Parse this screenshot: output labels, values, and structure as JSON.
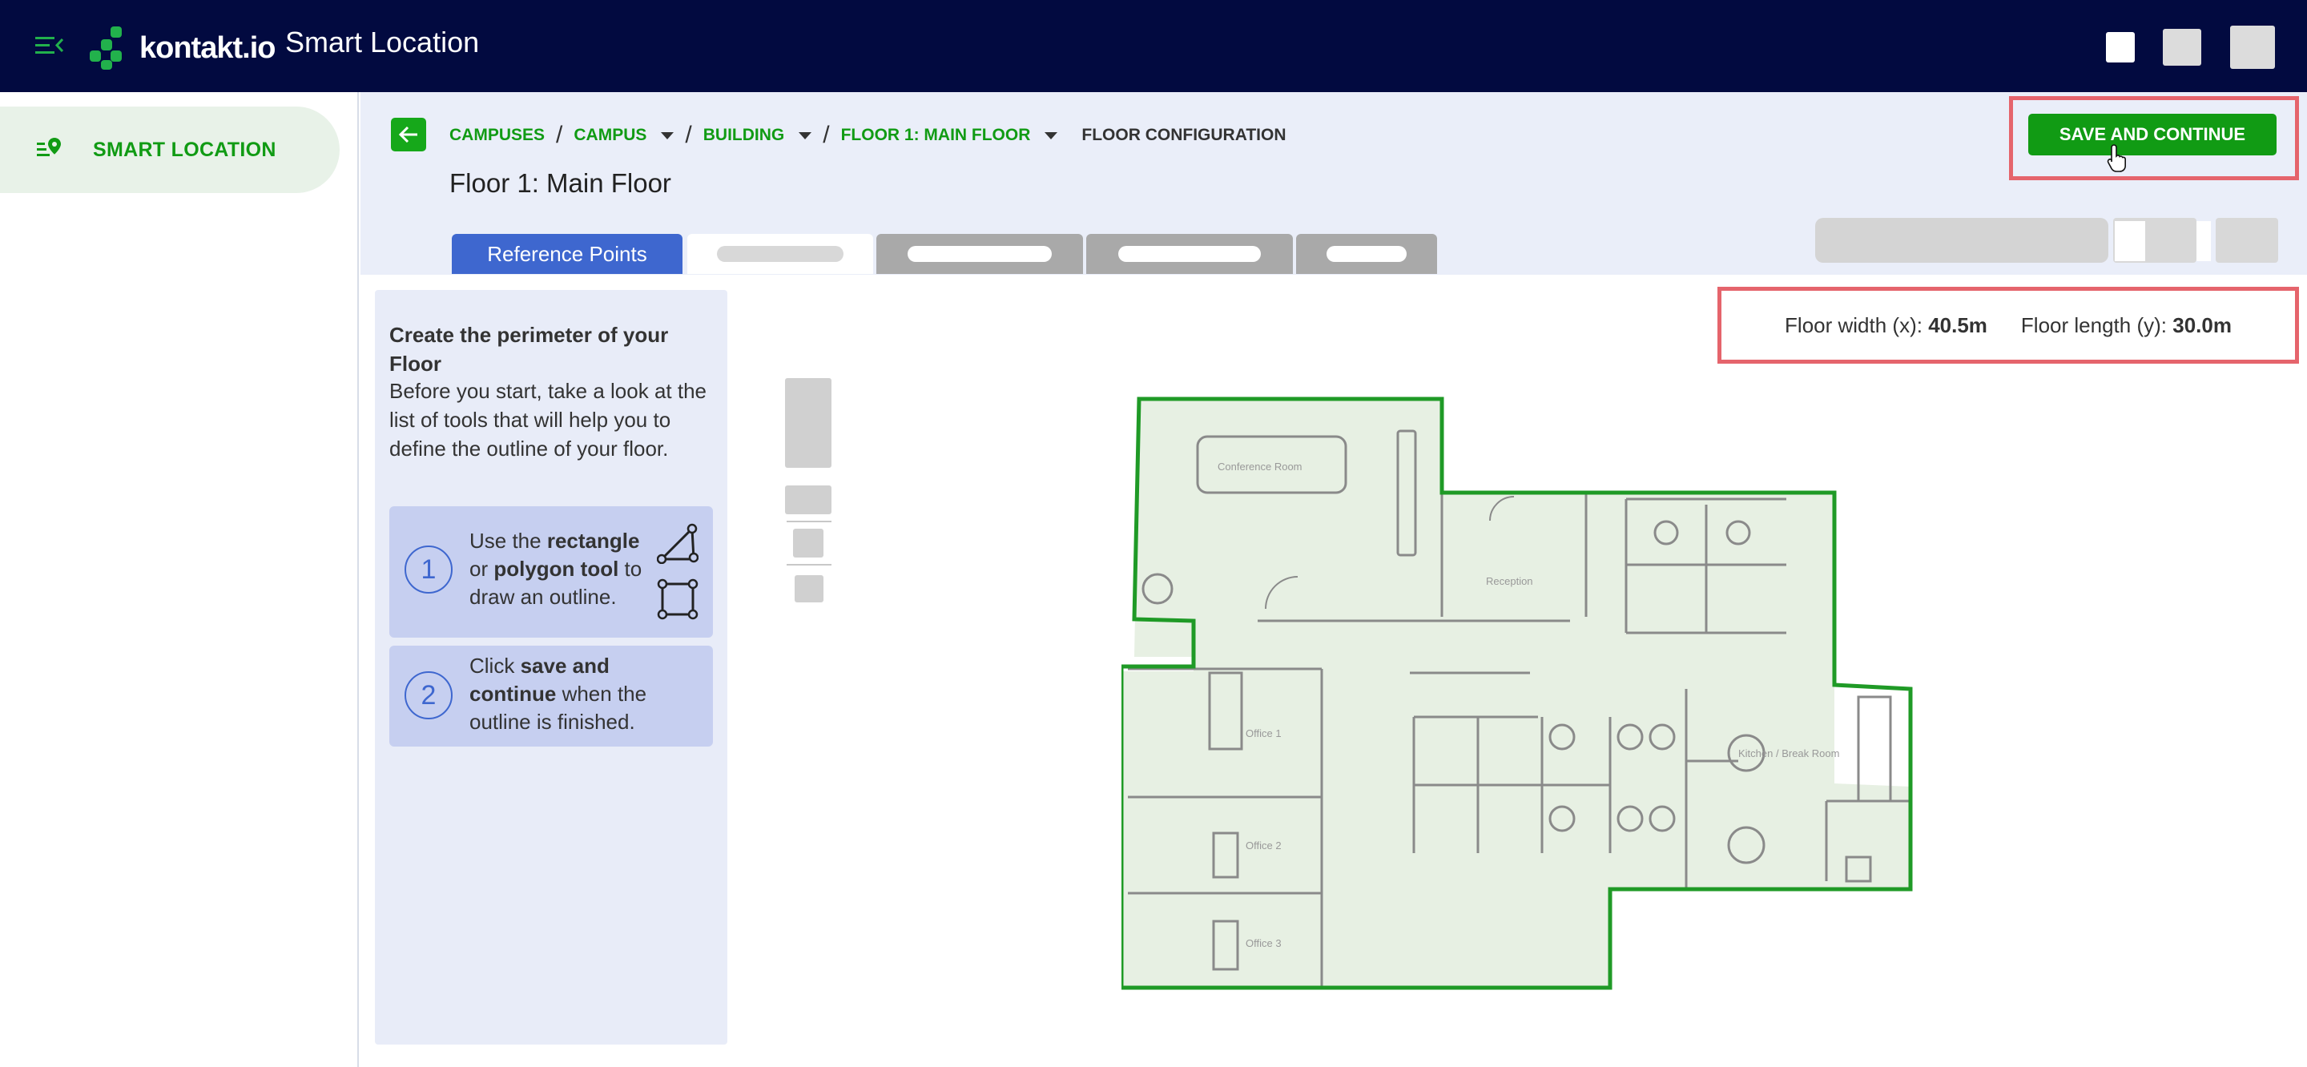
{
  "app": {
    "brand": "kontakt.io",
    "title": "Smart Location"
  },
  "sidebar": {
    "items": [
      {
        "label": "SMART LOCATION",
        "icon": "map-pin-list-icon"
      }
    ]
  },
  "breadcrumb": {
    "items": [
      "CAMPUSES",
      "CAMPUS",
      "BUILDING",
      "FLOOR 1: MAIN FLOOR"
    ],
    "current": "FLOOR CONFIGURATION",
    "separator": "/"
  },
  "page": {
    "title": "Floor 1: Main Floor"
  },
  "actions": {
    "save_label": "SAVE AND CONTINUE"
  },
  "tabs": {
    "active_label": "Reference Points"
  },
  "panel": {
    "title": "Create the perimeter of your Floor",
    "description": "Before you start, take a look at the list of tools that will help you to define the outline of your floor.",
    "steps": [
      {
        "number": "1",
        "pre": "Use the ",
        "bold1": "rectangle",
        "mid": " or ",
        "bold2": "polygon tool",
        "post": " to draw an outline."
      },
      {
        "number": "2",
        "pre": "Click ",
        "bold1": "save and continue",
        "post": " when the outline is finished."
      }
    ]
  },
  "floor": {
    "width_label": "Floor width (x):",
    "width_value": "40.5m",
    "length_label": "Floor length (y):",
    "length_value": "30.0m"
  },
  "rooms": {
    "conference": "Conference Room",
    "reception": "Reception",
    "office1": "Office 1",
    "office2": "Office 2",
    "office3": "Office 3",
    "kitchen": "Kitchen / Break Room"
  },
  "colors": {
    "topbar": "#020a40",
    "brand_green": "#119b14",
    "tab_active": "#3e67cf",
    "highlight": "#e5646c",
    "header_bg": "#eaeef9",
    "floor_outline": "#1f9a26",
    "floor_fill": "#e7f0e3"
  }
}
